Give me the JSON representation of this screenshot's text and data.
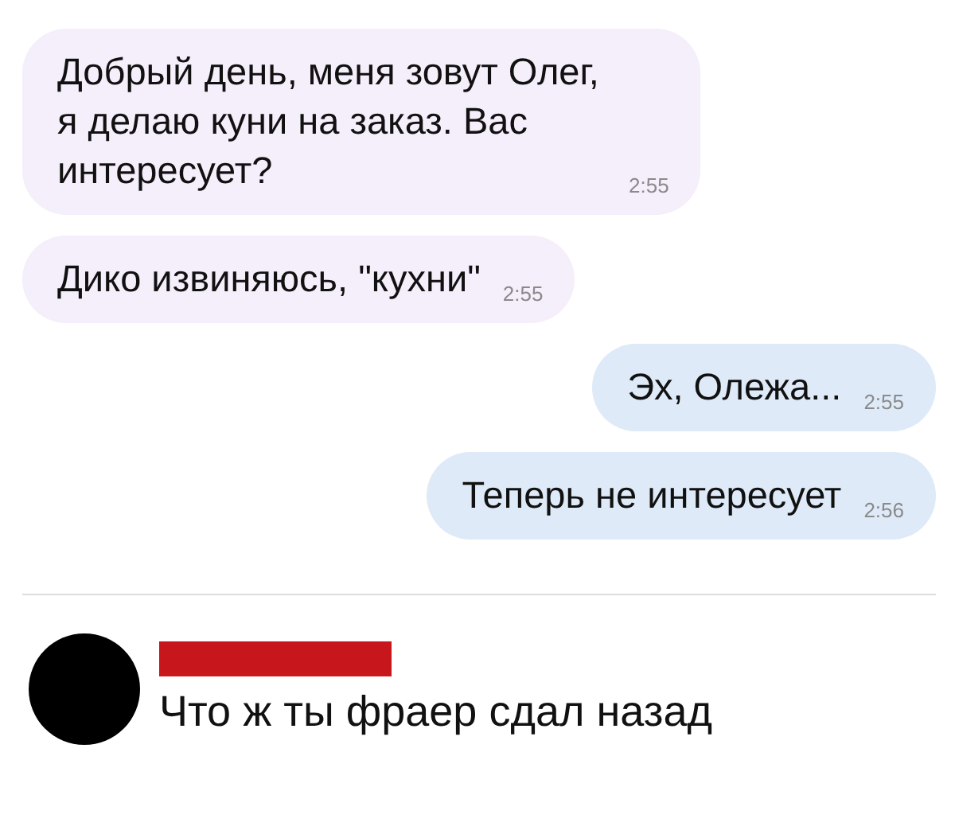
{
  "messages": [
    {
      "kind": "incoming",
      "text": "Добрый день, меня зовут Олег, я делаю куни на заказ. Вас интересует?",
      "time": "2:55"
    },
    {
      "kind": "incoming",
      "text": "Дико извиняюсь, \"кухни\"",
      "time": "2:55"
    },
    {
      "kind": "outgoing",
      "text": "Эх, Олежа...",
      "time": "2:55"
    },
    {
      "kind": "outgoing",
      "text": "Теперь не интересует",
      "time": "2:56"
    }
  ],
  "comment": {
    "author_redacted": true,
    "text": "Что ж ты фраер сдал назад"
  }
}
